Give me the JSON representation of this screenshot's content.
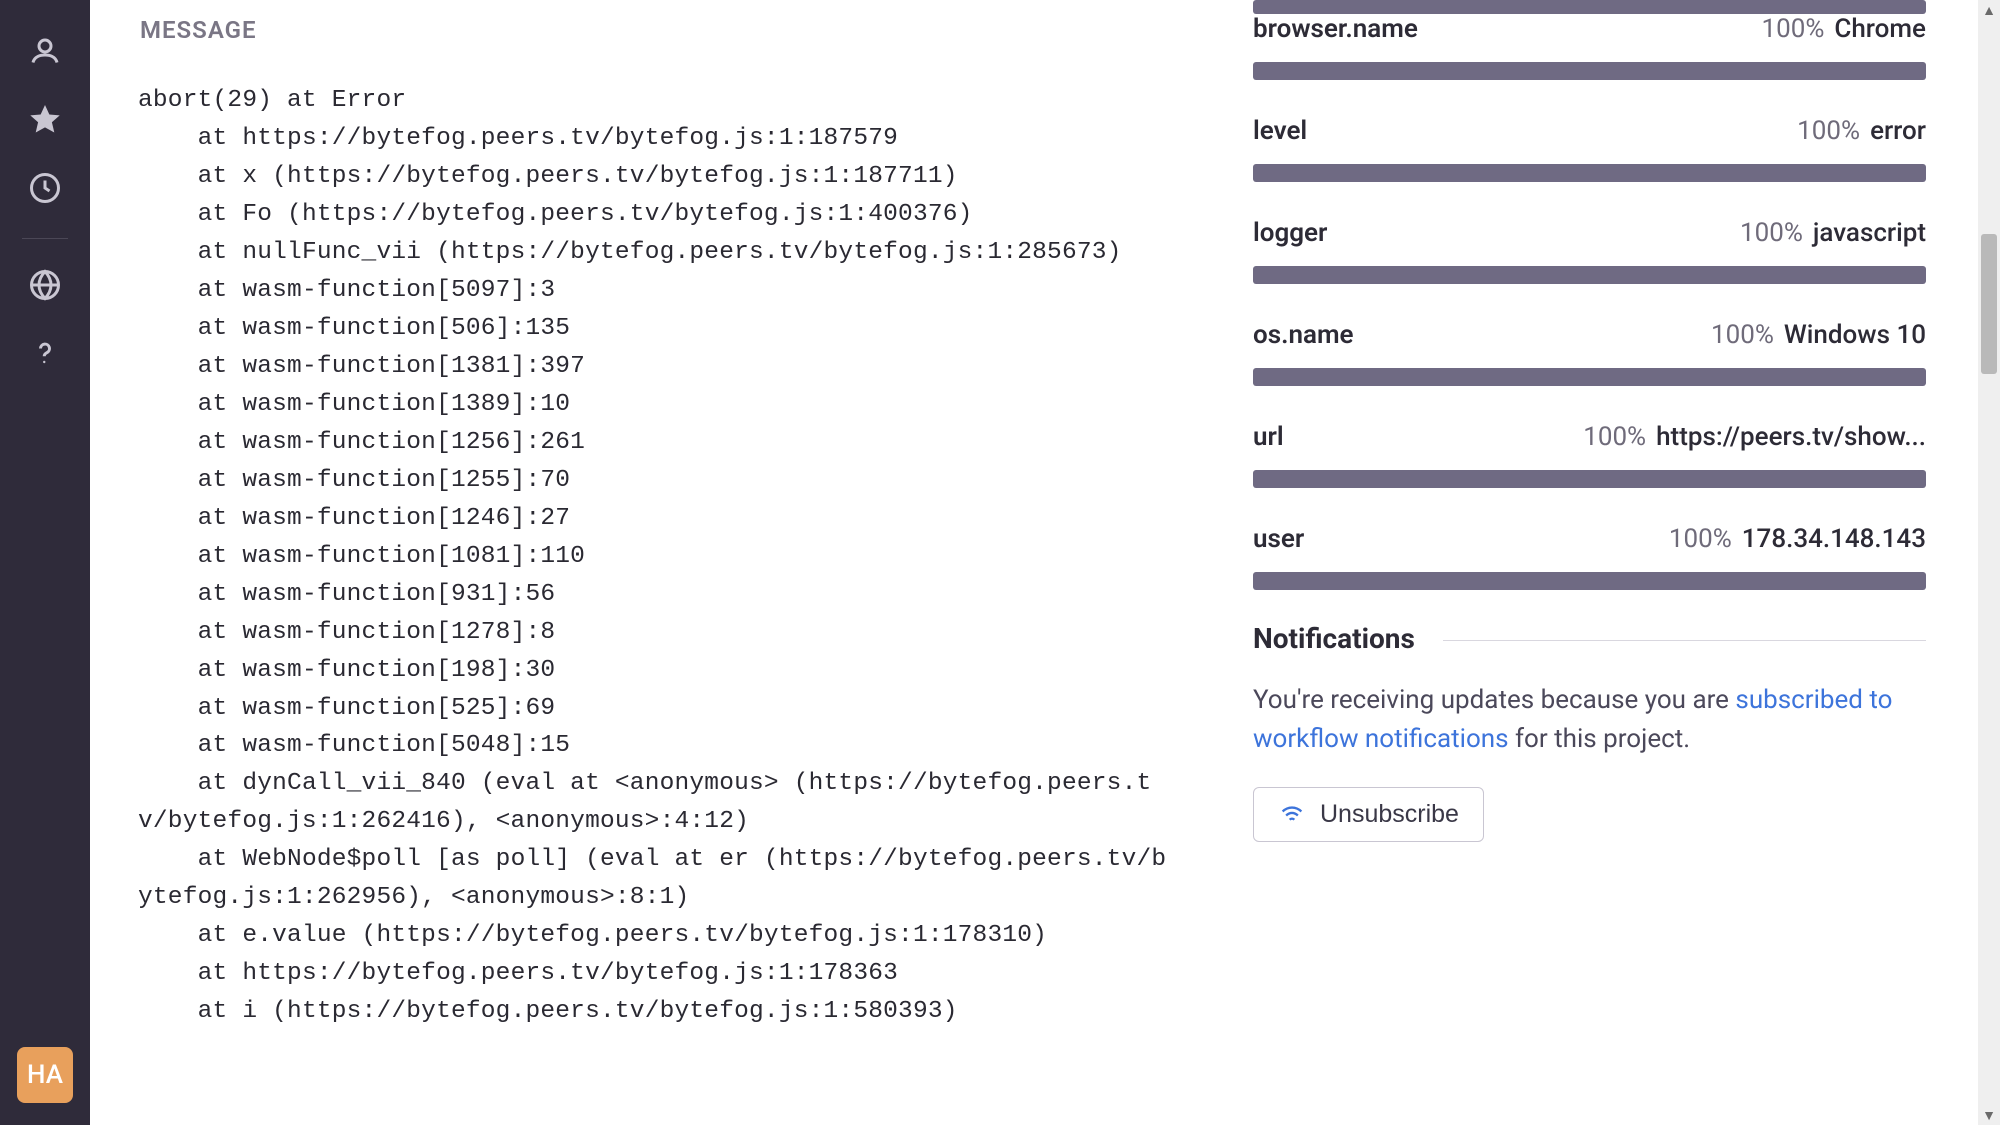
{
  "sidebar": {
    "avatar_initials": "HA"
  },
  "message": {
    "section_title": "MESSAGE",
    "stack_text": "abort(29) at Error\n    at https://bytefog.peers.tv/bytefog.js:1:187579\n    at x (https://bytefog.peers.tv/bytefog.js:1:187711)\n    at Fo (https://bytefog.peers.tv/bytefog.js:1:400376)\n    at nullFunc_vii (https://bytefog.peers.tv/bytefog.js:1:285673)\n    at wasm-function[5097]:3\n    at wasm-function[506]:135\n    at wasm-function[1381]:397\n    at wasm-function[1389]:10\n    at wasm-function[1256]:261\n    at wasm-function[1255]:70\n    at wasm-function[1246]:27\n    at wasm-function[1081]:110\n    at wasm-function[931]:56\n    at wasm-function[1278]:8\n    at wasm-function[198]:30\n    at wasm-function[525]:69\n    at wasm-function[5048]:15\n    at dynCall_vii_840 (eval at <anonymous> (https://bytefog.peers.tv/bytefog.js:1:262416), <anonymous>:4:12)\n    at WebNode$poll [as poll] (eval at er (https://bytefog.peers.tv/bytefog.js:1:262956), <anonymous>:8:1)\n    at e.value (https://bytefog.peers.tv/bytefog.js:1:178310)\n    at https://bytefog.peers.tv/bytefog.js:1:178363\n    at i (https://bytefog.peers.tv/bytefog.js:1:580393)"
  },
  "tags": [
    {
      "key": "browser.name",
      "pct": "100%",
      "value": "Chrome"
    },
    {
      "key": "level",
      "pct": "100%",
      "value": "error"
    },
    {
      "key": "logger",
      "pct": "100%",
      "value": "javascript"
    },
    {
      "key": "os.name",
      "pct": "100%",
      "value": "Windows 10"
    },
    {
      "key": "url",
      "pct": "100%",
      "value": "https://peers.tv/show..."
    },
    {
      "key": "user",
      "pct": "100%",
      "value": "178.34.148.143"
    }
  ],
  "notifications": {
    "heading": "Notifications",
    "text_prefix": "You're receiving updates because you are ",
    "link_text": "subscribed to workflow notifications",
    "text_suffix": " for this project.",
    "unsubscribe_label": "Unsubscribe"
  }
}
